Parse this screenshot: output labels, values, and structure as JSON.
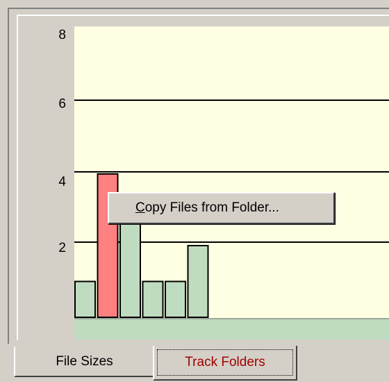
{
  "tabs": [
    {
      "label": "File Sizes"
    },
    {
      "label": "Track Folders"
    }
  ],
  "context_menu": {
    "item_mnemonic": "C",
    "item_rest": "opy Files from Folder..."
  },
  "colors": {
    "plot_bg": "#ffffe3",
    "bar_normal": "#c0dcc0",
    "bar_selected": "#ff8080",
    "active_tab_text": "#a00000"
  },
  "chart_data": {
    "type": "bar",
    "values": [
      1,
      4,
      3,
      1,
      1,
      2
    ],
    "selected_index": 1,
    "yticks": [
      "2",
      "4",
      "6",
      "8"
    ],
    "ylim": [
      0,
      8
    ],
    "grid": true
  }
}
